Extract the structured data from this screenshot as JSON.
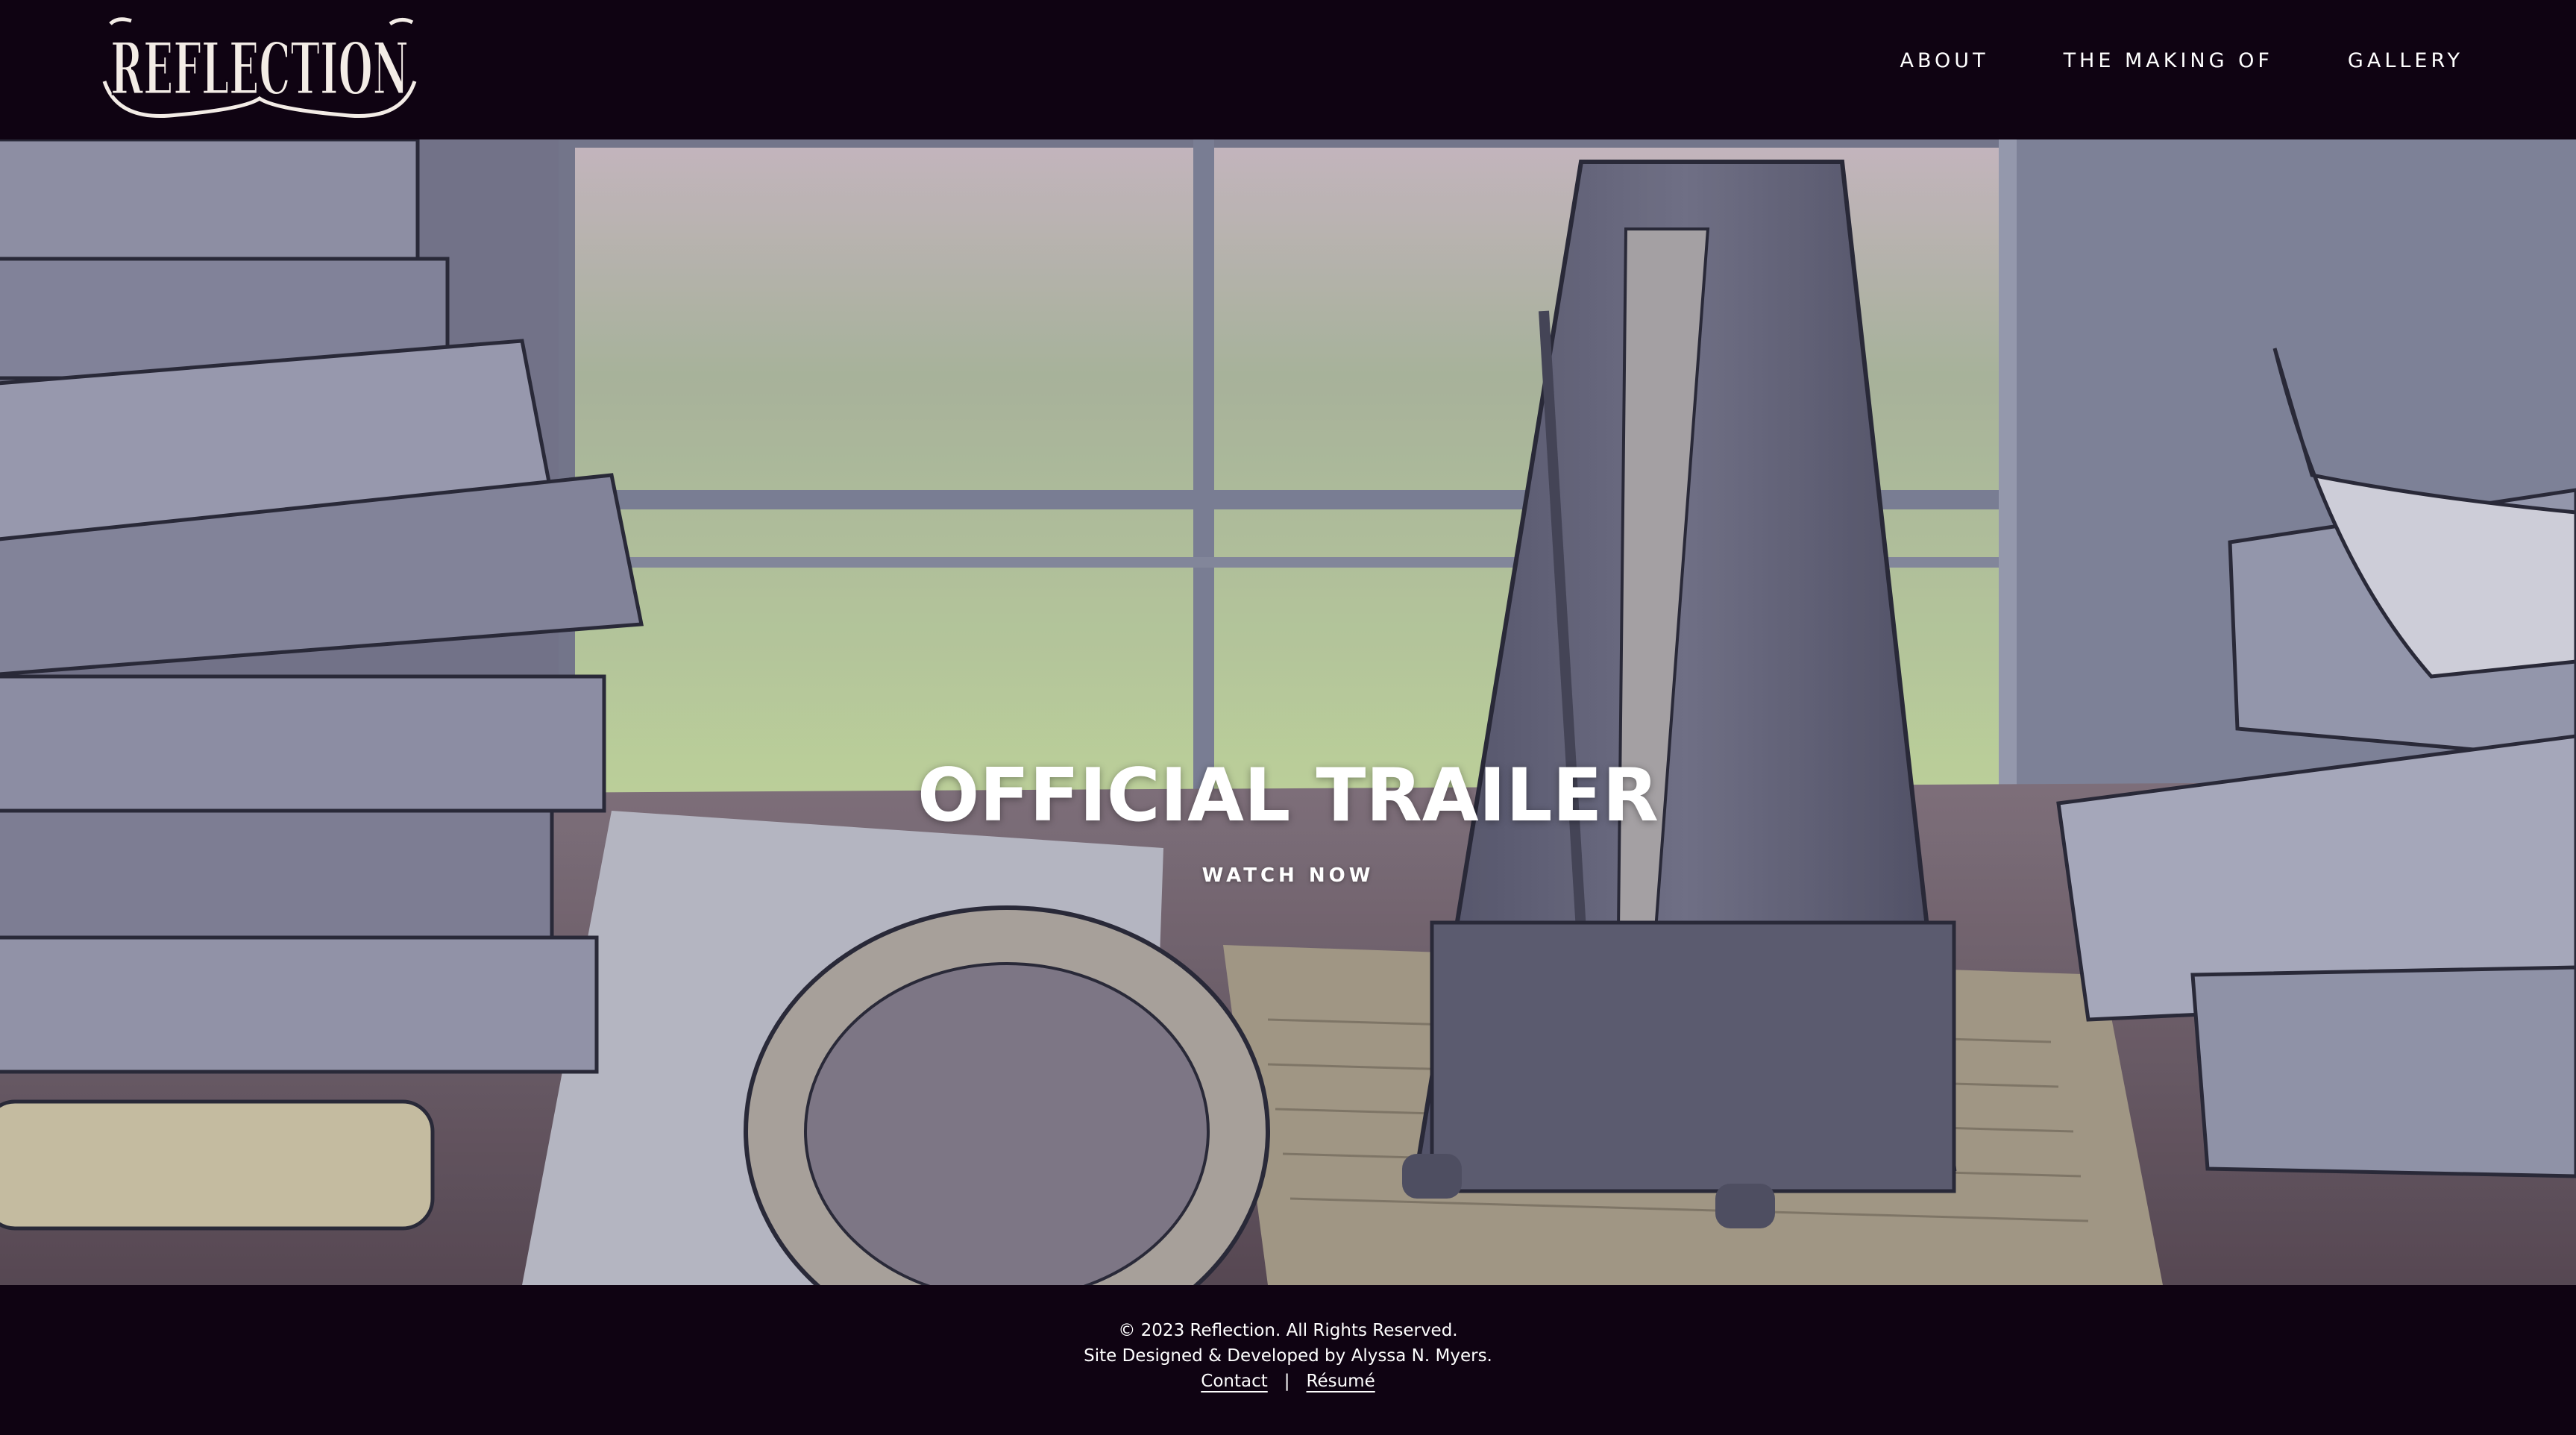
{
  "brand": {
    "logo_text": "REFLECTION"
  },
  "nav": {
    "items": [
      {
        "label": "ABOUT"
      },
      {
        "label": "THE MAKING OF"
      },
      {
        "label": "GALLERY"
      }
    ]
  },
  "hero": {
    "title": "OFFICIAL TRAILER",
    "cta_label": "WATCH NOW"
  },
  "footer": {
    "copyright": "© 2023 Reflection. All Rights Reserved.",
    "credit": "Site Designed & Developed by Alyssa N. Myers.",
    "contact_label": "Contact",
    "separator": "|",
    "resume_label": "Résumé"
  },
  "colors": {
    "header_bg": "#0f0312",
    "footer_bg": "#0f0312",
    "text": "#ffffff",
    "logo": "#f3ece6"
  }
}
